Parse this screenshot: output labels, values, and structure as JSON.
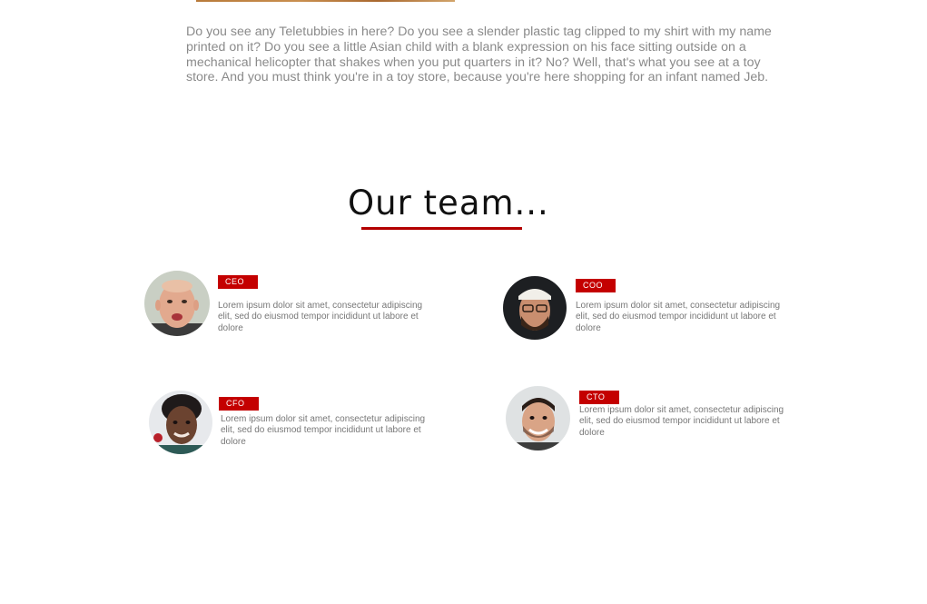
{
  "intro": {
    "text": "Do you see any Teletubbies in here? Do you see a slender plastic tag clipped to my shirt with my name printed on it? Do you see a little Asian child with a blank expression on his face sitting outside on a mechanical helicopter that shakes when you put quarters in it? No? Well, that's what you see at a toy store. And you must think you're in a toy store, because you're here shopping for an infant named Jeb."
  },
  "team": {
    "title": "Our team...",
    "members": [
      {
        "role": "CEO",
        "bio": "Lorem ipsum dolor sit amet, consectetur adipiscing elit, sed do eiusmod tempor incididunt ut labore et dolore"
      },
      {
        "role": "COO",
        "bio": "Lorem ipsum dolor sit amet, consectetur adipiscing elit, sed do eiusmod tempor incididunt ut labore et dolore"
      },
      {
        "role": "CFO",
        "bio": "Lorem ipsum dolor sit amet, consectetur adipiscing elit, sed do eiusmod tempor incididunt ut labore et dolore"
      },
      {
        "role": "CTO",
        "bio": "Lorem ipsum dolor sit amet, consectetur adipiscing elit, sed do eiusmod tempor incididunt ut labore et dolore"
      }
    ]
  },
  "colors": {
    "accent": "#c40000",
    "body_text": "#8a8a8a",
    "title_text": "#111111"
  }
}
